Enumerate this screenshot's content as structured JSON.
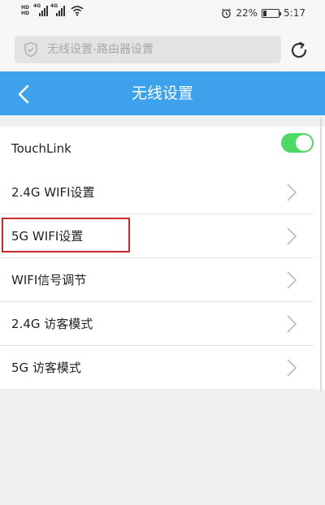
{
  "status_bar": {
    "hd_top": "HD",
    "hd_bottom": "HD",
    "signal_1_tag": "4G",
    "signal_2_tag": "4G",
    "battery_percent": "22%",
    "time": "5:17",
    "battery_level": 0.22
  },
  "search": {
    "placeholder": "无线设置-路由器设置"
  },
  "header": {
    "title": "无线设置"
  },
  "touchlink": {
    "label": "TouchLink",
    "enabled": true
  },
  "menu": {
    "items": [
      {
        "label": "2.4G WIFI设置"
      },
      {
        "label": "5G WIFI设置"
      },
      {
        "label": "WIFI信号调节"
      },
      {
        "label": "2.4G 访客模式"
      },
      {
        "label": "5G 访客模式"
      }
    ]
  },
  "colors": {
    "header_bg": "#3da2eb",
    "toggle_on": "#4cd964",
    "highlight": "#c62a2a"
  }
}
